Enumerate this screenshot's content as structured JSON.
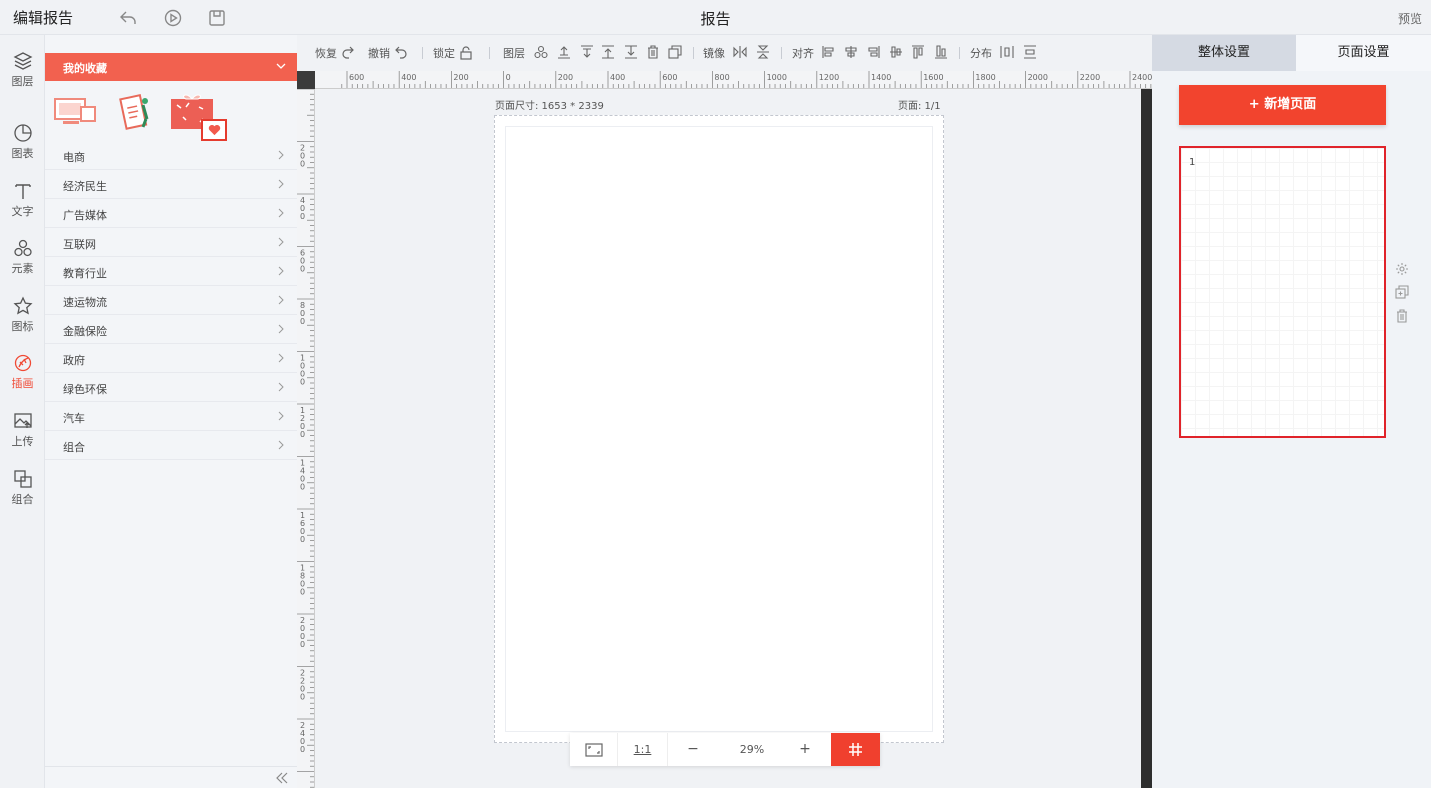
{
  "header": {
    "app_title": "编辑报告",
    "doc_title": "报告",
    "preview_label": "预览"
  },
  "rail": {
    "items": [
      {
        "label": "图层",
        "icon": "layers-icon"
      },
      {
        "label": "图表",
        "icon": "chart-pie-icon"
      },
      {
        "label": "文字",
        "icon": "text-icon"
      },
      {
        "label": "元素",
        "icon": "shapes-icon"
      },
      {
        "label": "图标",
        "icon": "star-icon"
      },
      {
        "label": "插画",
        "icon": "illustration-icon",
        "active": true
      },
      {
        "label": "上传",
        "icon": "upload-image-icon"
      },
      {
        "label": "组合",
        "icon": "group-icon"
      }
    ]
  },
  "panel": {
    "favorites_label": "我的收藏",
    "categories": [
      "电商",
      "经济民生",
      "广告媒体",
      "互联网",
      "教育行业",
      "速运物流",
      "金融保险",
      "政府",
      "绿色环保",
      "汽车",
      "组合"
    ]
  },
  "toolbar": {
    "redo_label": "恢复",
    "undo_label": "撤销",
    "lock_label": "锁定",
    "layer_label": "图层",
    "mirror_label": "镜像",
    "align_label": "对齐",
    "distribute_label": "分布"
  },
  "ruler": {
    "h_ticks": [
      "600",
      "400",
      "200",
      "0",
      "200",
      "400",
      "600",
      "800",
      "1000",
      "1200",
      "1400",
      "1600",
      "1800",
      "2000",
      "2200",
      "2400"
    ],
    "v_ticks": [
      "2\n0\n0",
      "4\n0\n0",
      "6\n0\n0",
      "8\n0\n0",
      "1\n0\n0\n0",
      "1\n2\n0\n0",
      "1\n4\n0\n0",
      "1\n6\n0\n0",
      "1\n8\n0\n0",
      "2\n0\n0\n0",
      "2\n2\n0\n0",
      "2\n4\n0\n0"
    ]
  },
  "canvas": {
    "page_size": "页面尺寸: 1653 * 2339",
    "page_count": "页面: 1/1"
  },
  "zoom": {
    "ratio_label": "1:1",
    "minus": "−",
    "value": "29%",
    "plus": "+"
  },
  "right_panel": {
    "tab_global": "整体设置",
    "tab_page": "页面设置",
    "add_page_label": "+ 新增页面",
    "page_number": "1"
  },
  "colors": {
    "accent": "#f2442e",
    "active_rail": "#f04a35"
  }
}
